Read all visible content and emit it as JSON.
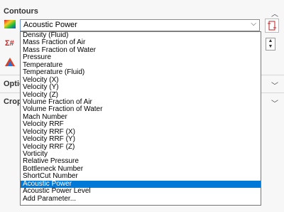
{
  "header": {
    "title": "Contours"
  },
  "combo": {
    "selected": "Acoustic Power"
  },
  "dropdown": {
    "items": [
      "Density (Fluid)",
      "Mass Fraction of Air",
      "Mass Fraction of Water",
      "Pressure",
      "Temperature",
      "Temperature (Fluid)",
      "Velocity (X)",
      "Velocity (Y)",
      "Velocity (Z)",
      "Volume Fraction of Air",
      "Volume Fraction of Water",
      "Mach Number",
      "Velocity RRF",
      "Velocity RRF (X)",
      "Velocity RRF (Y)",
      "Velocity RRF (Z)",
      "Vorticity",
      "Relative Pressure",
      "Bottleneck Number",
      "ShortCut Number",
      "Acoustic Power",
      "Acoustic Power Level",
      "Add Parameter..."
    ],
    "selected_index": 20
  },
  "sections": {
    "options_label": "Optio",
    "crop_label": "Crop"
  }
}
